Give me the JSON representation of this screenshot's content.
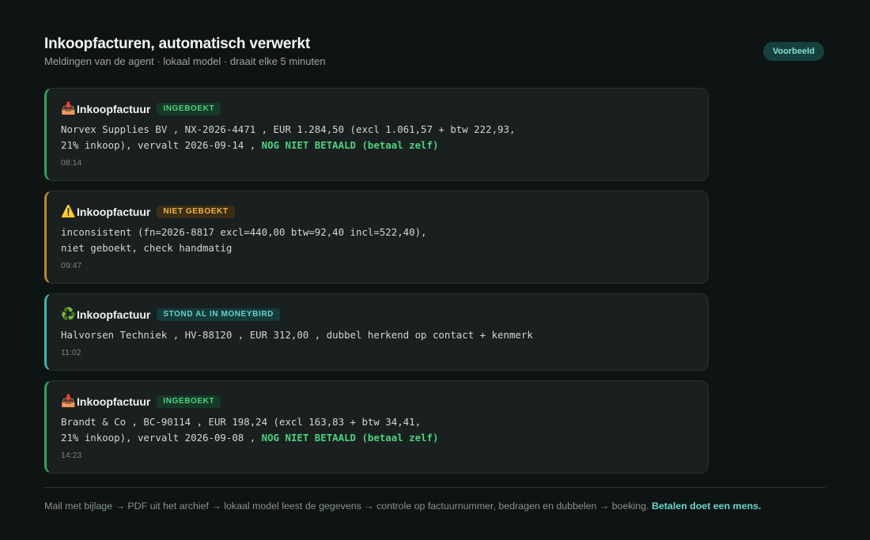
{
  "header": {
    "title": "Inkoopfacturen, automatisch verwerkt",
    "subtitle": "Meldingen van de agent · lokaal model · draait elke 5 minuten",
    "badge": "Voorbeeld"
  },
  "cards": [
    {
      "icon": "inbox-tray-icon",
      "icon_glyph": "📥",
      "title": "Inkoopfactuur",
      "tag": "INGEBOEKT",
      "status": "ok",
      "lines": [
        "Norvex Supplies BV , NX-2026-4471 , EUR 1.284,50 (excl 1.061,57 + btw 222,93,",
        "21% inkoop), vervalt 2026-09-14 , "
      ],
      "unpaid": "NOG NIET BETAALD (betaal zelf)",
      "time": "08:14"
    },
    {
      "icon": "warning-icon",
      "icon_glyph": "⚠️",
      "title": "Inkoopfactuur",
      "tag": "NIET GEBOEKT",
      "status": "warn",
      "lines": [
        "inconsistent (fn=2026-8817 excl=440,00 btw=92,40 incl=522,40),",
        "niet geboekt, check handmatig"
      ],
      "unpaid": "",
      "time": "09:47"
    },
    {
      "icon": "recycle-icon",
      "icon_glyph": "♻️",
      "title": "Inkoopfactuur",
      "tag": "STOND AL IN MONEYBIRD",
      "status": "dup",
      "lines": [
        "Halvorsen Techniek , HV-88120 , EUR 312,00 , dubbel herkend op contact + kenmerk"
      ],
      "unpaid": "",
      "time": "11:02"
    },
    {
      "icon": "inbox-tray-icon",
      "icon_glyph": "📥",
      "title": "Inkoopfactuur",
      "tag": "INGEBOEKT",
      "status": "ok",
      "lines": [
        "Brandt & Co , BC-90114 , EUR 198,24 (excl 163,83 + btw 34,41,",
        "21% inkoop), vervalt 2026-09-08 , "
      ],
      "unpaid": "NOG NIET BETAALD (betaal zelf)",
      "time": "14:23"
    }
  ],
  "footer": {
    "text": "Mail met bijlage → PDF uit het archief → lokaal model leest de gegevens → controle op factuurnummer, bedragen en dubbelen → boeking. ",
    "emphasis": "Betalen doet een mens."
  },
  "colors": {
    "background": "#0e1413",
    "card": "#19201f",
    "ok": "#4fd081",
    "warn": "#f0b24a",
    "dup": "#66d3cb",
    "accent": "#6ad6c9"
  }
}
